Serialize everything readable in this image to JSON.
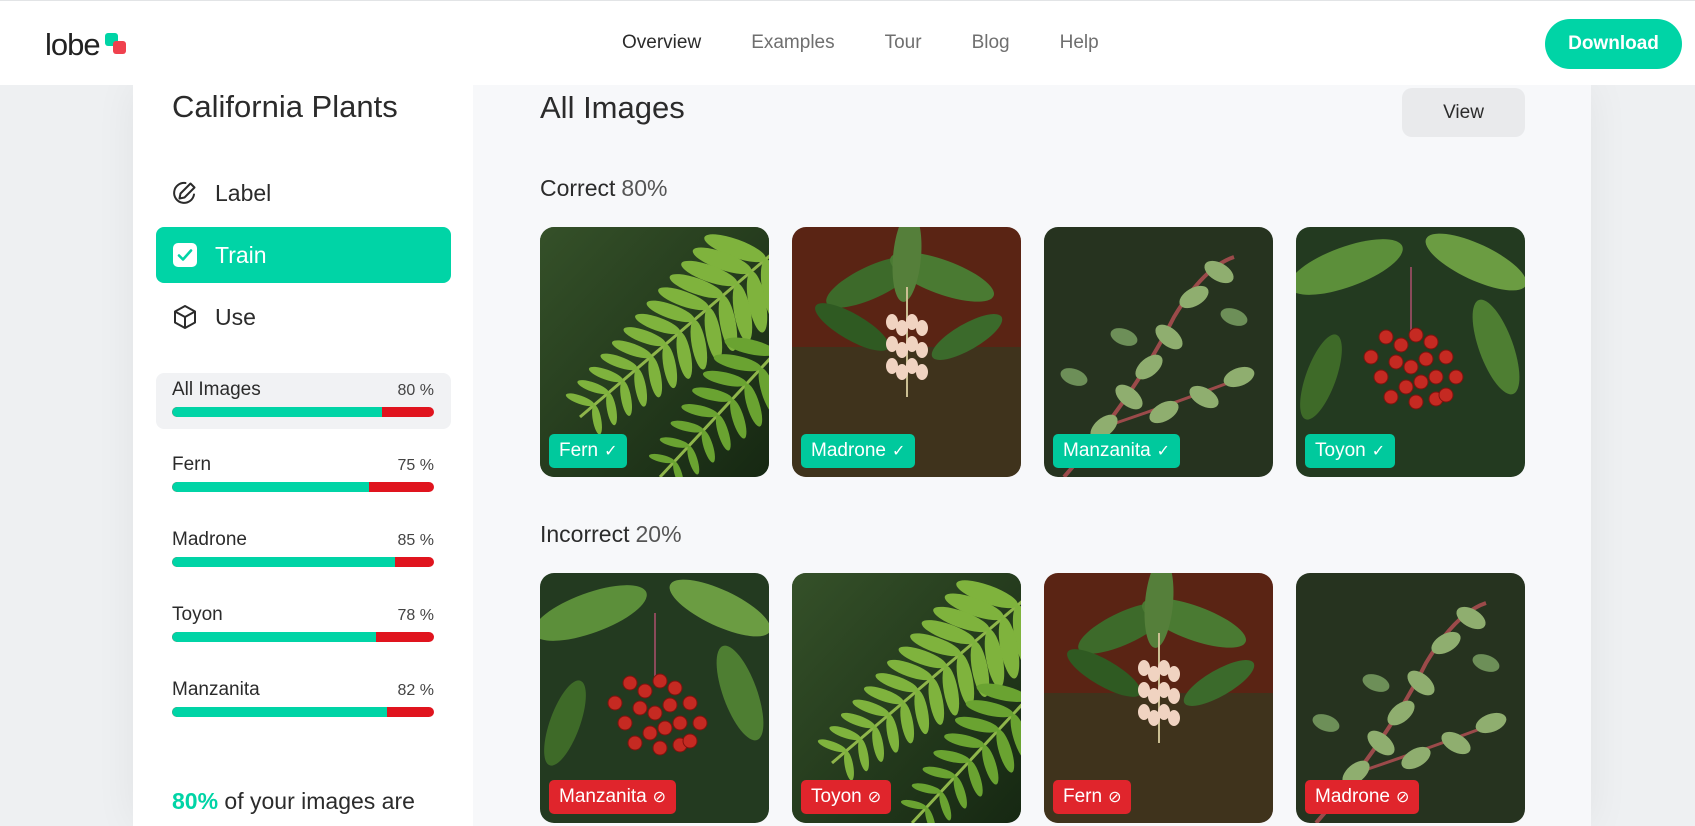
{
  "nav": {
    "logo": "lobe",
    "links": [
      "Overview",
      "Examples",
      "Tour",
      "Blog",
      "Help"
    ],
    "active": "Overview",
    "download_label": "Download"
  },
  "colors": {
    "accent": "#00d4a6",
    "error": "#e0141e",
    "text": "#2b2b2b"
  },
  "sidebar": {
    "project_title": "California Plants",
    "modes": [
      {
        "label": "Label",
        "icon": "pencil-circle-icon",
        "active": false
      },
      {
        "label": "Train",
        "icon": "check-square-icon",
        "active": true
      },
      {
        "label": "Use",
        "icon": "cube-icon",
        "active": false
      }
    ],
    "stats": [
      {
        "name": "All Images",
        "pct_label": "80 %",
        "accuracy": 0.8,
        "selected": true
      },
      {
        "name": "Fern",
        "pct_label": "75 %",
        "accuracy": 0.75,
        "selected": false
      },
      {
        "name": "Madrone",
        "pct_label": "85 %",
        "accuracy": 0.85,
        "selected": false
      },
      {
        "name": "Toyon",
        "pct_label": "78 %",
        "accuracy": 0.78,
        "selected": false
      },
      {
        "name": "Manzanita",
        "pct_label": "82 %",
        "accuracy": 0.82,
        "selected": false
      }
    ],
    "summary": {
      "highlight": "80%",
      "text": " of your images are"
    }
  },
  "main": {
    "title": "All Images",
    "view_label": "View",
    "correct": {
      "label": "Correct",
      "pct": "80%",
      "images": [
        {
          "label": "Fern",
          "status": "correct",
          "mark": "✓",
          "photo": "fern"
        },
        {
          "label": "Madrone",
          "status": "correct",
          "mark": "✓",
          "photo": "madrone"
        },
        {
          "label": "Manzanita",
          "status": "correct",
          "mark": "✓",
          "photo": "manzanita"
        },
        {
          "label": "Toyon",
          "status": "correct",
          "mark": "✓",
          "photo": "toyon"
        }
      ]
    },
    "incorrect": {
      "label": "Incorrect",
      "pct": "20%",
      "images": [
        {
          "label": "Manzanita",
          "status": "incorrect",
          "mark": "⊘",
          "photo": "toyon"
        },
        {
          "label": "Toyon",
          "status": "incorrect",
          "mark": "⊘",
          "photo": "fern"
        },
        {
          "label": "Fern",
          "status": "incorrect",
          "mark": "⊘",
          "photo": "madrone"
        },
        {
          "label": "Madrone",
          "status": "incorrect",
          "mark": "⊘",
          "photo": "manzanita"
        }
      ]
    }
  }
}
